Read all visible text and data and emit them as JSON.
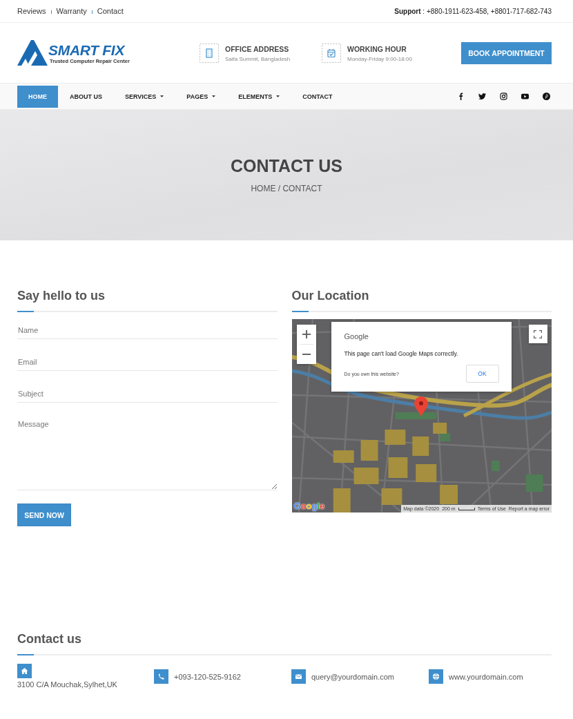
{
  "top_bar": {
    "links": [
      "Reviews",
      "Warranty",
      "Contact"
    ],
    "support": "**Support** : +880-1911-623-458, +8801-717-682-743"
  },
  "header": {
    "logo": {
      "name": "SMART FIX",
      "tagline": "Trusted Computer Repair Center"
    },
    "info": [
      {
        "kind": "address",
        "title": "OFFICE ADDRESS",
        "text": "Saifa Summit, Bangladesh"
      },
      {
        "kind": "hours",
        "title": "WORKING HOUR",
        "text": "Monday-Friday 9:00-18:00"
      }
    ],
    "button": "BOOK APPOINTMENT"
  },
  "nav": [
    {
      "label": "HOME",
      "selected": true,
      "dropdown": false
    },
    {
      "label": "ABOUT US",
      "selected": false,
      "dropdown": false
    },
    {
      "label": "SERVICES",
      "selected": false,
      "dropdown": true
    },
    {
      "label": "PAGES",
      "selected": false,
      "dropdown": true
    },
    {
      "label": "ELEMENTS",
      "selected": false,
      "dropdown": true
    },
    {
      "label": "CONTACT",
      "selected": false,
      "dropdown": false
    }
  ],
  "banner": {
    "title": "CONTACT US",
    "breadcrumb": "HOME / CONTACT"
  },
  "contact_form": {
    "title": "Say hello to us",
    "fields": [
      {
        "kind": "input",
        "placeholder": "Name"
      },
      {
        "kind": "input",
        "placeholder": "Email"
      },
      {
        "kind": "input",
        "placeholder": "Subject"
      },
      {
        "kind": "textarea",
        "placeholder": "Message"
      }
    ],
    "button": "SEND NOW"
  },
  "location": {
    "title": "Our Location",
    "map": {
      "dialog": {
        "brand": "Google",
        "message": "This page can't load Google Maps correctly.",
        "question": "Do you own this website?",
        "button": "OK"
      },
      "logo": "Google",
      "attribution": [
        "Map data ©2020",
        "200 m",
        "Terms of Use",
        "Report a map error"
      ]
    }
  },
  "contact_info": {
    "title": "Contact us",
    "items": [
      {
        "kind": "address",
        "text": "3100 C/A Mouchak,Sylhet,UK"
      },
      {
        "kind": "phone",
        "text": "+093-120-525-9162"
      },
      {
        "kind": "email",
        "text": "query@yourdomain.com"
      },
      {
        "kind": "web",
        "text": "www.yourdomain.com"
      }
    ]
  }
}
